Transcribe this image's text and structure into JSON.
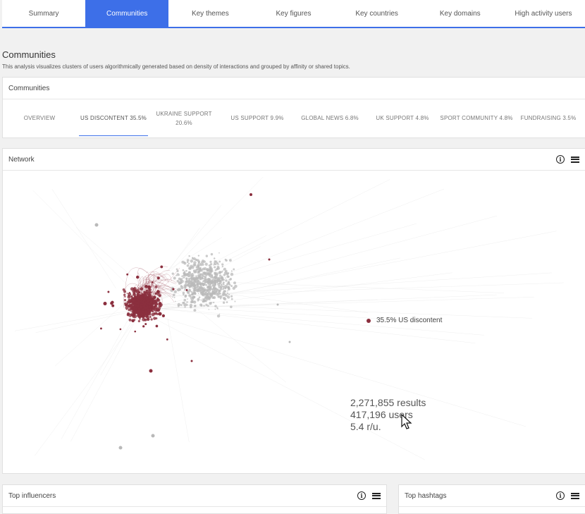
{
  "nav": {
    "tabs": [
      {
        "label": "Summary"
      },
      {
        "label": "Communities"
      },
      {
        "label": "Key themes"
      },
      {
        "label": "Key figures"
      },
      {
        "label": "Key countries"
      },
      {
        "label": "Key domains"
      },
      {
        "label": "High activity users"
      }
    ],
    "active": "Communities"
  },
  "page": {
    "title": "Communities",
    "description": "This analysis visualizes clusters of users algorithmically generated based on density of interactions and grouped by affinity or shared topics."
  },
  "communities_panel": {
    "title": "Communities",
    "tabs": [
      {
        "label": "OVERVIEW"
      },
      {
        "label": "US DISCONTENT 35.5%"
      },
      {
        "label": "UKRAINE SUPPORT\n20.6%"
      },
      {
        "label": "US SUPPORT 9.9%"
      },
      {
        "label": "GLOBAL NEWS 6.8%"
      },
      {
        "label": "UK SUPPORT 4.8%"
      },
      {
        "label": "SPORT COMMUNITY 4.8%"
      },
      {
        "label": "FUNDRAISING 3.5%"
      }
    ],
    "active_tab": "US DISCONTENT 35.5%"
  },
  "network_panel": {
    "title": "Network",
    "legend_label": "35.5% US discontent",
    "legend_color": "#8b2f3e",
    "stats": {
      "results": "2,271,855 results",
      "users": "417,196 users",
      "ratio": "5.4 r/u."
    },
    "icons": [
      "info-icon",
      "menu-icon"
    ]
  },
  "influencers_panel": {
    "title": "Top influencers"
  },
  "hashtags_panel": {
    "title": "Top hashtags"
  },
  "colors": {
    "accent": "#3d6fe8",
    "community_highlight": "#8b2f3e",
    "other_nodes": "#b9b9b9"
  }
}
